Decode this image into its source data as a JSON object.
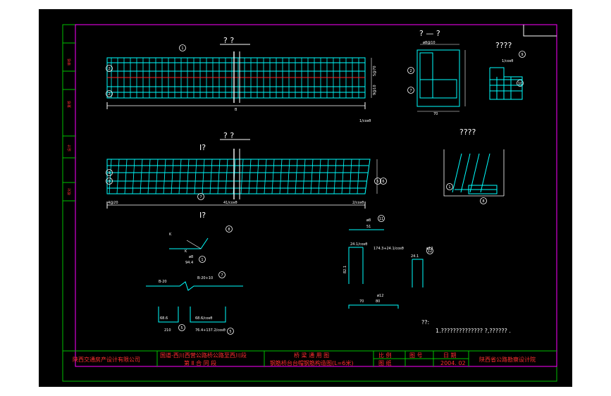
{
  "drawing": {
    "titles": {
      "main_plan": "?  ?",
      "main_elev": "?  ?",
      "section_small": "? — ?",
      "section_right": "????",
      "detail_right": "????",
      "section_mark_top": "I?",
      "section_mark_bottom": "I?"
    },
    "side_stamps": [
      "审核",
      "复核",
      "设计",
      "校对"
    ],
    "dims": {
      "plan_total": "B",
      "plan_right": "1/cosθ",
      "elev_total": "41/cosθ",
      "elev_right": "2/cosθ",
      "elev_left": "4@20",
      "plan_v1": "5@70",
      "plan_v2": "9@10"
    },
    "markers": [
      "1",
      "2",
      "3",
      "4",
      "5",
      "6",
      "7",
      "8",
      "9",
      "10",
      "11",
      "12"
    ],
    "bars": {
      "b1_top": "ø8",
      "b1_len": "94.4",
      "b7_label": "B-20",
      "b7_right": "B-20+10",
      "b5_left": "68.6",
      "b5_len": "210",
      "b5_right": "68.6/cosθ",
      "b5_len2": "76.4+137.2/cosθ",
      "b11_top": "ø8",
      "b11_len": "51",
      "b12_a": "24.1/cosθ",
      "b12_b": "174.3+24.1/cosθ",
      "b12_c": "82.1",
      "b12_d": "ø12",
      "b12_e": "24.1",
      "b10_a": "ø12",
      "b10_b": "80",
      "b10_c": "70"
    },
    "notes": {
      "heading": "??:",
      "line1": "1.??????????????   ?,?????? ."
    },
    "title_block": {
      "company": "陕西交通房产设计有限公司",
      "project_line1": "国道-西川西营公路桥公路至西川段",
      "project_line2": "第 Ⅱ 合 同 段",
      "drawing_line1": "桥 梁 通 用 图",
      "drawing_line2": "钢筋桥台台帽钢筋构造图(L=6米)",
      "scale_label": "比 例",
      "sheet_label": "图 号",
      "date_label": "日 期",
      "date_value": "2004. 02",
      "drawing_no_label": "图 纸",
      "institute": "陕西省公路勘察设计院"
    }
  }
}
